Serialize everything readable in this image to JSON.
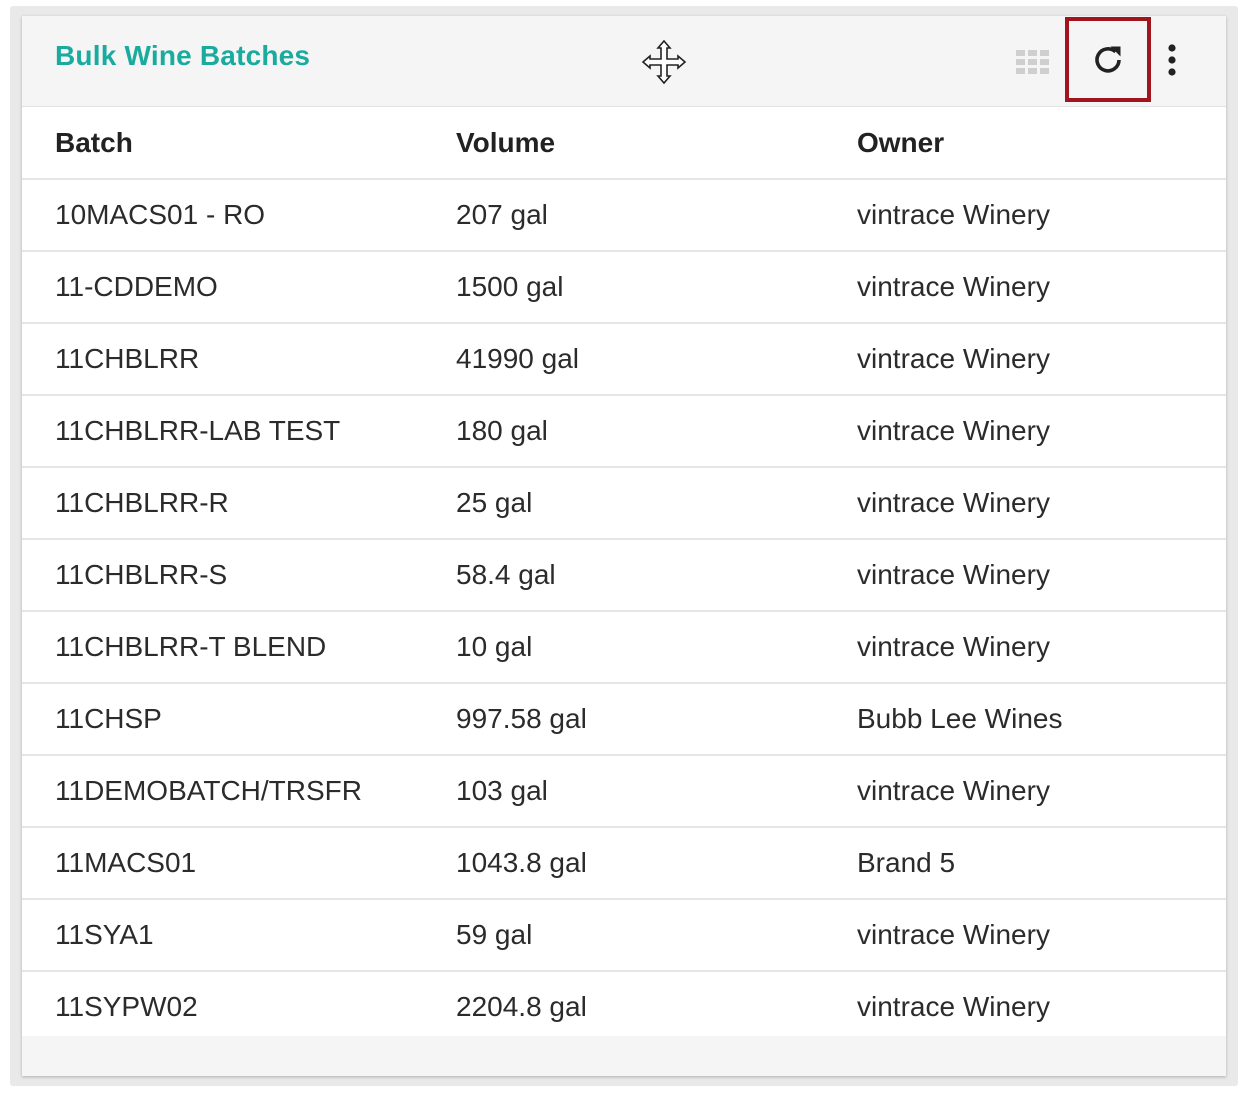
{
  "widget": {
    "title": "Bulk Wine Batches",
    "accent_color": "#1aab9f",
    "highlight_color": "#a0141e",
    "icons": {
      "move": "move-arrows-icon",
      "grid": "grid-icon",
      "refresh": "refresh-icon",
      "menu": "kebab-menu-icon"
    }
  },
  "table": {
    "columns": [
      "Batch",
      "Volume",
      "Owner"
    ],
    "rows": [
      {
        "batch": "10MACS01 - RO",
        "volume": "207 gal",
        "owner": "vintrace Winery"
      },
      {
        "batch": "11-CDDEMO",
        "volume": "1500 gal",
        "owner": "vintrace Winery"
      },
      {
        "batch": "11CHBLRR",
        "volume": "41990 gal",
        "owner": "vintrace Winery"
      },
      {
        "batch": "11CHBLRR-LAB TEST",
        "volume": "180 gal",
        "owner": "vintrace Winery"
      },
      {
        "batch": "11CHBLRR-R",
        "volume": "25 gal",
        "owner": "vintrace Winery"
      },
      {
        "batch": "11CHBLRR-S",
        "volume": "58.4 gal",
        "owner": "vintrace Winery"
      },
      {
        "batch": "11CHBLRR-T BLEND",
        "volume": "10 gal",
        "owner": "vintrace Winery"
      },
      {
        "batch": "11CHSP",
        "volume": "997.58 gal",
        "owner": "Bubb Lee Wines"
      },
      {
        "batch": "11DEMOBATCH/TRSFR",
        "volume": "103 gal",
        "owner": "vintrace Winery"
      },
      {
        "batch": "11MACS01",
        "volume": "1043.8 gal",
        "owner": "Brand 5"
      },
      {
        "batch": "11SYA1",
        "volume": "59 gal",
        "owner": "vintrace Winery"
      },
      {
        "batch": "11SYPW02",
        "volume": "2204.8 gal",
        "owner": "vintrace Winery"
      }
    ]
  }
}
